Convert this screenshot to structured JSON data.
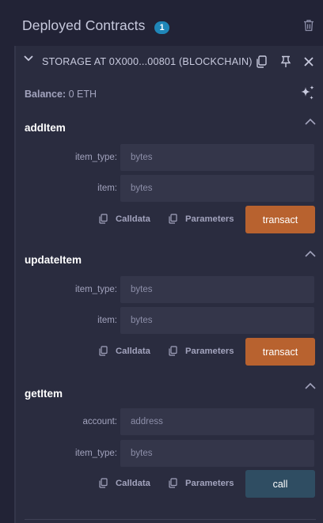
{
  "header": {
    "title": "Deployed Contracts",
    "count": "1"
  },
  "contract": {
    "name": "STORAGE AT 0X000...00801 (BLOCKCHAIN)",
    "balance_label": "Balance:",
    "balance_value": "0 ETH"
  },
  "functions": [
    {
      "name": "addItem",
      "params": [
        {
          "label": "item_type:",
          "placeholder": "bytes"
        },
        {
          "label": "item:",
          "placeholder": "bytes"
        }
      ],
      "calldata_label": "Calldata",
      "parameters_label": "Parameters",
      "action_label": "transact",
      "action_kind": "transact"
    },
    {
      "name": "updateItem",
      "params": [
        {
          "label": "item_type:",
          "placeholder": "bytes"
        },
        {
          "label": "item:",
          "placeholder": "bytes"
        }
      ],
      "calldata_label": "Calldata",
      "parameters_label": "Parameters",
      "action_label": "transact",
      "action_kind": "transact"
    },
    {
      "name": "getItem",
      "params": [
        {
          "label": "account:",
          "placeholder": "address"
        },
        {
          "label": "item_type:",
          "placeholder": "bytes"
        }
      ],
      "calldata_label": "Calldata",
      "parameters_label": "Parameters",
      "action_label": "call",
      "action_kind": "call"
    }
  ],
  "colors": {
    "background": "#222336",
    "card": "#2a2c3f",
    "input": "#34364a",
    "transact": "#b8622f",
    "call": "#2f4d62",
    "badge": "#1f86b8"
  },
  "icons": [
    "trash-icon",
    "chevron-down-icon",
    "copy-icon",
    "pin-icon",
    "close-icon",
    "sparkle-icon",
    "chevron-up-icon"
  ]
}
